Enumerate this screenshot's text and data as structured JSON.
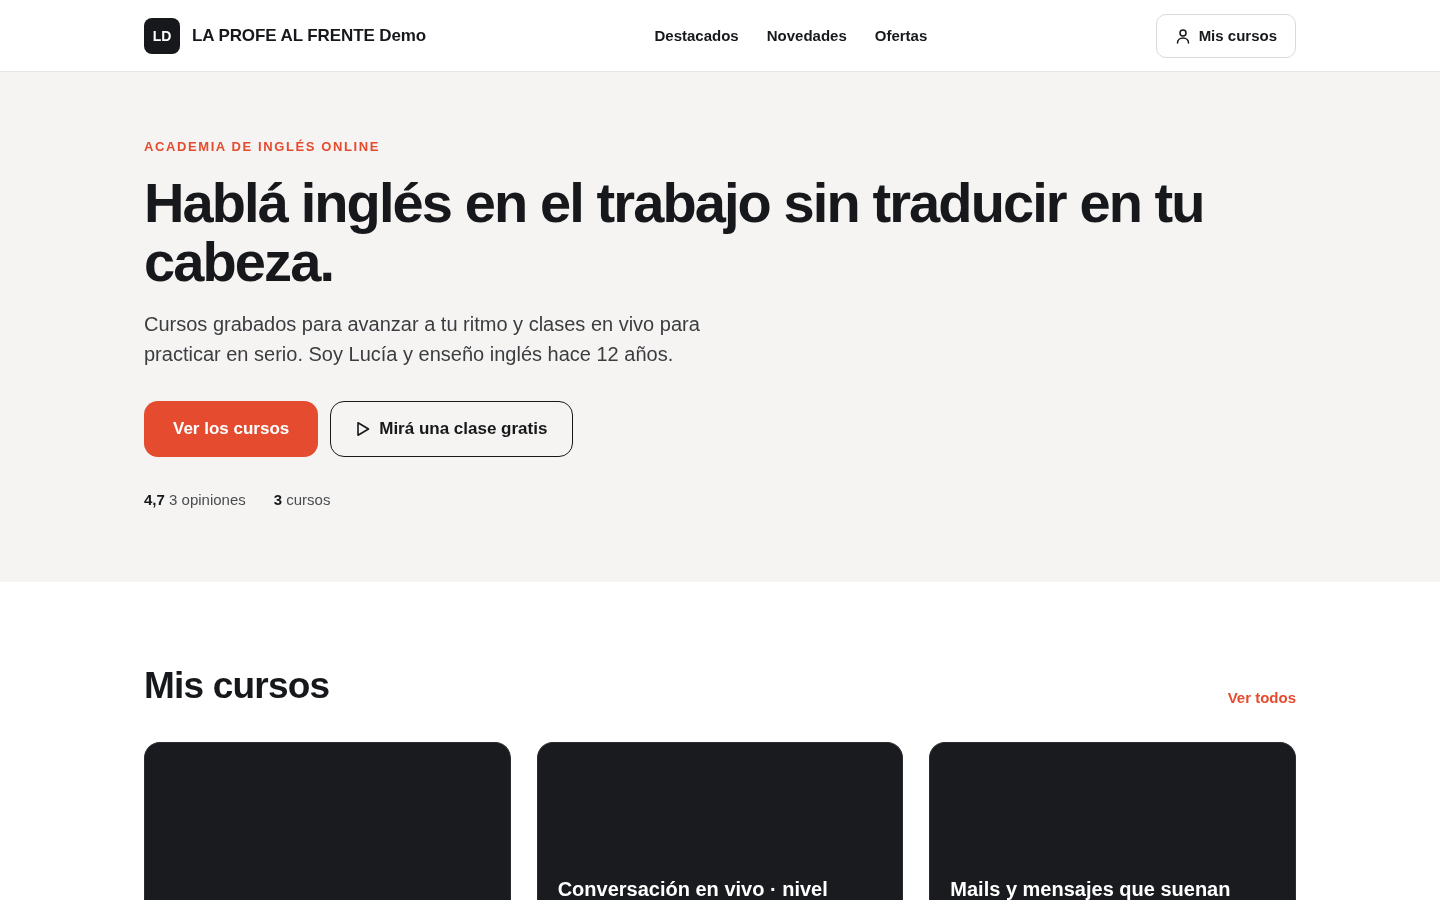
{
  "header": {
    "logo": "LD",
    "brand": "LA PROFE AL FRENTE Demo",
    "nav": [
      {
        "label": "Destacados"
      },
      {
        "label": "Novedades"
      },
      {
        "label": "Ofertas"
      }
    ],
    "account_button": "Mis cursos"
  },
  "hero": {
    "eyebrow": "ACADEMIA DE INGLÉS ONLINE",
    "title": "Hablá inglés en el trabajo sin traducir en tu cabeza.",
    "subtitle": "Cursos grabados para avanzar a tu ritmo y clases en vivo para practicar en serio. Soy Lucía y enseño inglés hace 12 años.",
    "buttons": [
      {
        "kind": "primary",
        "label": "Ver los cursos"
      },
      {
        "kind": "outline",
        "label": "Mirá una clase gratis"
      }
    ],
    "stats": [
      "**4,7** 3 opiniones",
      "**3** cursos"
    ]
  },
  "courses": {
    "title": "Mis cursos",
    "link": "Ver todos",
    "items": [
      {
        "kind": "plain"
      },
      {
        "kind": "titled",
        "title": "Conversación en vivo · nivel"
      },
      {
        "kind": "titled",
        "title": "Mails y mensajes que suenan"
      }
    ]
  }
}
